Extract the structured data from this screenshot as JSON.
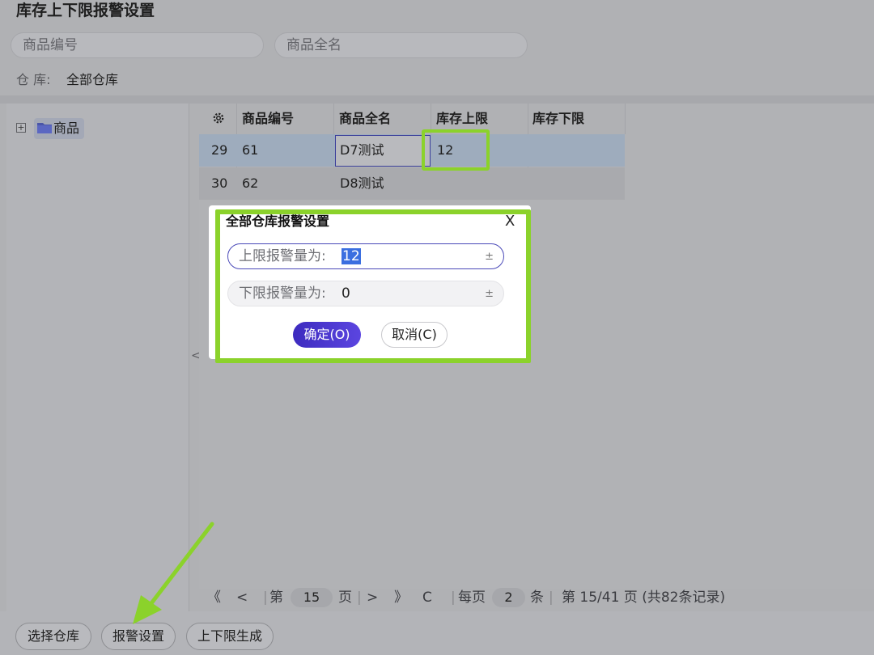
{
  "title": "库存上下限报警设置",
  "filters": {
    "product_code_placeholder": "商品编号",
    "product_name_placeholder": "商品全名"
  },
  "warehouse": {
    "label": "仓 库:",
    "value": "全部仓库"
  },
  "tree": {
    "toggle": "+",
    "root_label": "商品"
  },
  "collapse_icon": "<",
  "grid": {
    "headers": [
      "商品编号",
      "商品全名",
      "库存上限",
      "库存下限"
    ],
    "settings_icon": "gear-icon",
    "rows": [
      {
        "index": "29",
        "code": "61",
        "name": "D7测试",
        "upper": "12",
        "lower": ""
      },
      {
        "index": "30",
        "code": "62",
        "name": "D8测试",
        "upper": "",
        "lower": ""
      }
    ]
  },
  "pager": {
    "first": "《",
    "prev": "<",
    "page_prefix": "第",
    "page": "15",
    "page_suffix": "页",
    "next": ">",
    "last": "》",
    "refresh": "C",
    "per_page_prefix": "每页",
    "per_page": "2",
    "per_page_suffix": "条",
    "summary": "第 15/41 页 (共82条记录)"
  },
  "bottom_buttons": {
    "select_warehouse": "选择仓库",
    "alarm_settings": "报警设置",
    "generate_limits": "上下限生成"
  },
  "dialog": {
    "title": "全部仓库报警设置",
    "close": "X",
    "upper_label": "上限报警量为:",
    "upper_value": "12",
    "lower_label": "下限报警量为:",
    "lower_value": "0",
    "field_icon": "±",
    "ok": "确定(O)",
    "cancel": "取消(C)"
  },
  "colors": {
    "highlight": "#8bd22b",
    "primary": "#4a35d0"
  }
}
